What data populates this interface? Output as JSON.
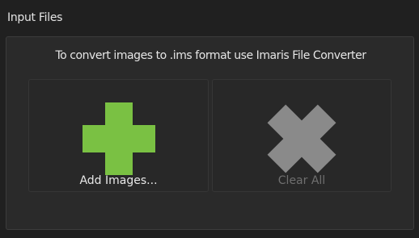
{
  "panel": {
    "title": "Input Files",
    "hint": "To convert images to .ims format use Imaris File Converter"
  },
  "actions": {
    "add_label": "Add Images...",
    "clear_label": "Clear All",
    "add_icon": "plus-icon",
    "clear_icon": "x-icon",
    "clear_enabled": false
  },
  "colors": {
    "add_icon": "#7ac143",
    "clear_icon": "#8a8a8a",
    "background": "#202020"
  }
}
